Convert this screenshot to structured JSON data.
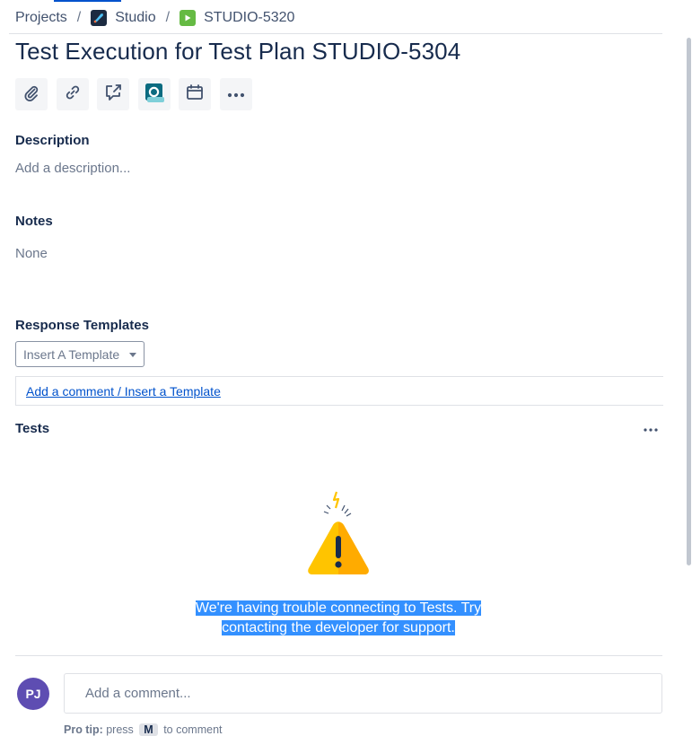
{
  "breadcrumbs": {
    "projects": "Projects",
    "separator": "/",
    "project": "Studio",
    "issue_key": "STUDIO-5320"
  },
  "issue": {
    "title": "Test Execution for Test Plan STUDIO-5304"
  },
  "toolbar": {
    "buttons": [
      "paperclip-icon",
      "link-icon",
      "share-icon",
      "app-icon",
      "calendar-icon",
      "more-icon"
    ]
  },
  "description": {
    "label": "Description",
    "placeholder": "Add a description..."
  },
  "notes": {
    "label": "Notes",
    "value": "None"
  },
  "response_templates": {
    "label": "Response Templates",
    "select_value": "Insert A Template",
    "link_text": "Add a comment / Insert a Template"
  },
  "tests": {
    "label": "Tests",
    "error_line1": "We're having trouble connecting to Tests. Try",
    "error_line2": "contacting the developer for support."
  },
  "comment": {
    "avatar_initials": "PJ",
    "placeholder": "Add a comment...",
    "protip_label": "Pro tip:",
    "protip_text": "press",
    "protip_key": "M",
    "protip_suffix": "to comment"
  },
  "colors": {
    "primary_text": "#172b4d",
    "muted_text": "#6b778c",
    "link": "#0052cc",
    "avatar": "#5e4db2",
    "warning": "#ffab00",
    "selection": "#3390ff"
  }
}
